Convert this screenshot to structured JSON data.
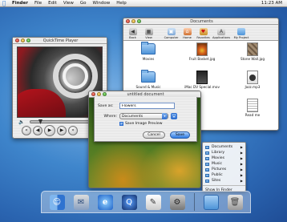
{
  "menubar": {
    "app": "Finder",
    "items": [
      "File",
      "Edit",
      "View",
      "Go",
      "Window",
      "Help"
    ],
    "clock": "11:23 AM"
  },
  "quicktime": {
    "title": "QuickTime Player"
  },
  "finder": {
    "title": "Documents",
    "toolbar": [
      "Back",
      "View",
      "Computer",
      "Home",
      "Favorites",
      "Applications",
      "My Project"
    ],
    "files": [
      {
        "name": "Movies",
        "icon": "folder-icon"
      },
      {
        "name": "Fruit Basket.jpg",
        "icon": "image-document-icon"
      },
      {
        "name": "Stone Wall.jpg",
        "icon": "image-document-icon"
      },
      {
        "name": "Sound & Music",
        "icon": "folder-icon"
      },
      {
        "name": "iMac DV Special.mov",
        "icon": "movie-document-icon"
      },
      {
        "name": "Jazz.mp3",
        "icon": "audio-document-icon"
      },
      {
        "name": "Read me",
        "icon": "text-document-icon"
      }
    ]
  },
  "document": {
    "title": "untitled document"
  },
  "save_sheet": {
    "save_as_label": "Save as:",
    "save_as_value": "Flowers",
    "where_label": "Where:",
    "where_value": "Documents",
    "checkbox_label": "Save Image Preview",
    "cancel_label": "Cancel",
    "save_label": "Save"
  },
  "dock_menu": {
    "items": [
      "Documents",
      "Library",
      "Movies",
      "Music",
      "Pictures",
      "Public",
      "Sites"
    ],
    "show_in_finder": "Show In Finder"
  },
  "dock": {
    "icons": [
      "finder-icon",
      "mail-icon",
      "internet-explorer-icon",
      "quicktime-icon",
      "textedit-icon",
      "system-preferences-icon",
      "documents-folder-icon",
      "trash-icon"
    ]
  }
}
